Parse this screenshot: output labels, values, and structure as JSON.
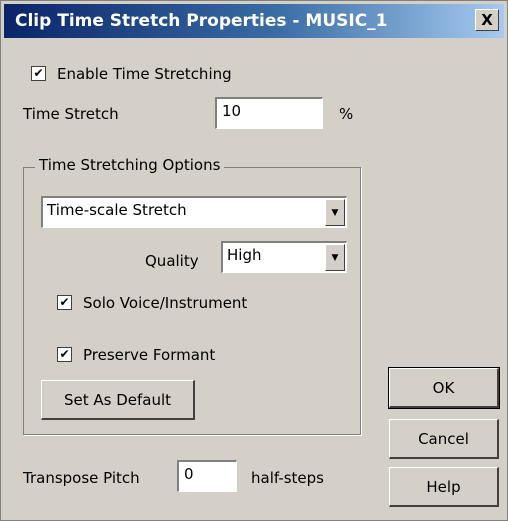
{
  "window": {
    "title": "Clip Time Stretch Properties - MUSIC_1",
    "close_label": "X"
  },
  "enable_time_stretching": {
    "label": "Enable Time Stretching",
    "checked": true
  },
  "time_stretch": {
    "label": "Time Stretch",
    "value": "10",
    "unit": "%"
  },
  "options_group": {
    "label": "Time Stretching Options",
    "mode": {
      "value": "Time-scale Stretch"
    },
    "quality": {
      "label": "Quality",
      "value": "High"
    },
    "solo_voice": {
      "label": "Solo Voice/Instrument",
      "checked": true
    },
    "preserve_formant": {
      "label": "Preserve Formant",
      "checked": true
    },
    "set_default_label": "Set As Default"
  },
  "buttons": {
    "ok": "OK",
    "cancel": "Cancel",
    "help": "Help"
  },
  "transpose_pitch": {
    "label": "Transpose Pitch",
    "value": "0",
    "unit": "half-steps"
  },
  "glyphs": {
    "check": "✔",
    "dropdown": "▼"
  }
}
